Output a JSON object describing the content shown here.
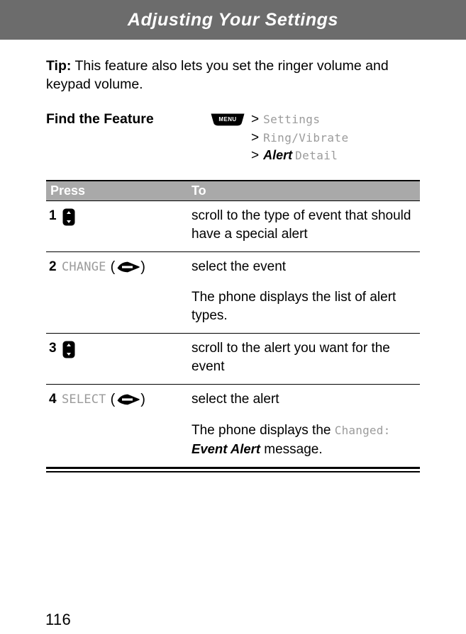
{
  "header": {
    "title": "Adjusting Your Settings",
    "bar_color": "#6c6c6c",
    "text_color": "#ffffff"
  },
  "tip": {
    "label": "Tip:",
    "text": " This feature also lets you set the ringer volume and keypad volume."
  },
  "find_feature": {
    "label": "Find the Feature",
    "menu_key_label": "MENU",
    "menu_key_icon": "menu-key-icon",
    "path": [
      {
        "separator": ">",
        "emphasis": "",
        "text": "Settings"
      },
      {
        "separator": ">",
        "emphasis": "",
        "text": "Ring/Vibrate"
      },
      {
        "separator": ">",
        "emphasis": "Alert",
        "text": "Detail"
      }
    ]
  },
  "steps_table": {
    "header_bg": "#a9a9a9",
    "columns": [
      {
        "label": "Press"
      },
      {
        "label": "To"
      }
    ],
    "rows": [
      {
        "number": "1",
        "key_label": "",
        "key_icon": "scroll-key-icon",
        "lines": [
          {
            "text": "scroll to the type of event that should have a special alert"
          }
        ]
      },
      {
        "number": "2",
        "key_label": "CHANGE",
        "key_icon": "soft-key-icon",
        "lines": [
          {
            "text": "select the event"
          },
          {
            "text": "The phone displays the list of alert types."
          }
        ]
      },
      {
        "number": "3",
        "key_label": "",
        "key_icon": "scroll-key-icon",
        "lines": [
          {
            "text": "scroll to the alert you want for the event"
          }
        ]
      },
      {
        "number": "4",
        "key_label": "SELECT",
        "key_icon": "soft-key-icon",
        "lines": [
          {
            "text": "select the alert"
          },
          {
            "prefix": "The phone displays the ",
            "mono": "Changed:",
            "italic": " Event Alert",
            "suffix": " message."
          }
        ]
      }
    ]
  },
  "footer": {
    "page_number": "116"
  }
}
